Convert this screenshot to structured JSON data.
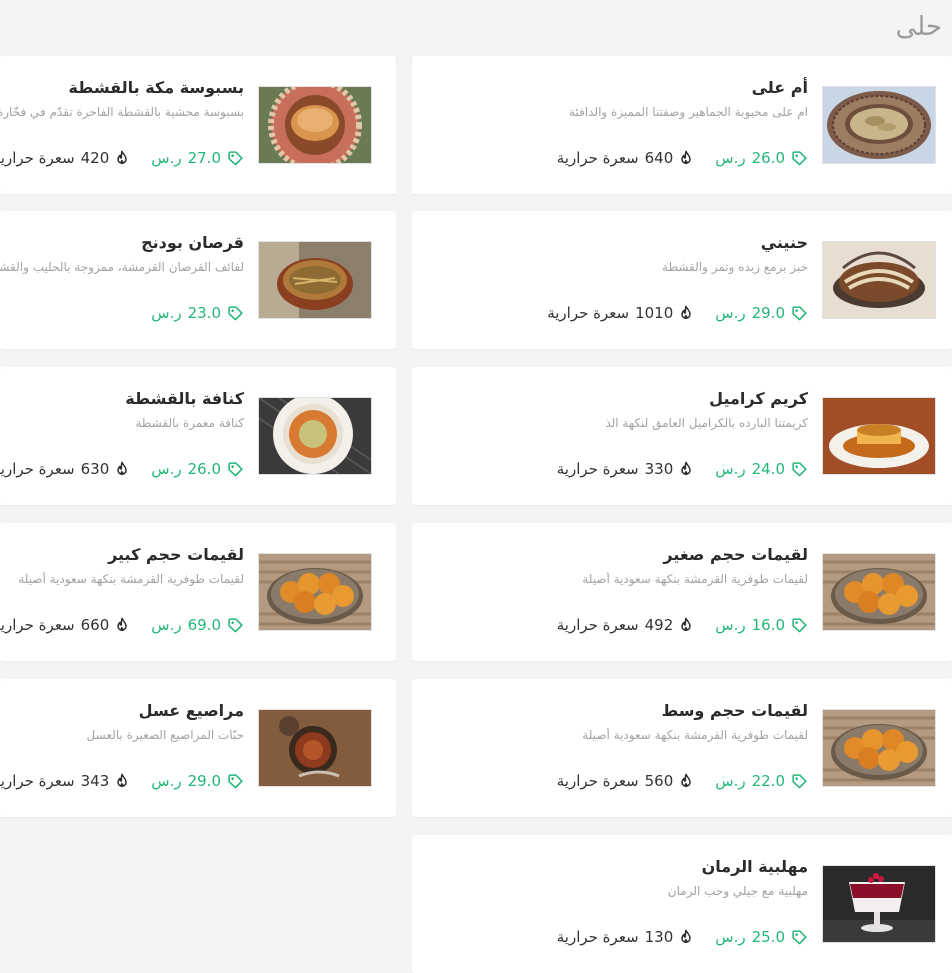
{
  "section": {
    "title": "حلى"
  },
  "items": [
    {
      "name": "أم على",
      "desc": "ام على محبوبة الجماهير وصفتنا المميزة والدافئة",
      "price": "26.0",
      "currency": "ر.س",
      "calories": "640",
      "cal_label": "سعرة حرارية",
      "image": "um-ali-bowl"
    },
    {
      "name": "بسبوسة مكة بالقشطة",
      "desc": "بسبوسة محشية بالقشطة الفاخرة تقدّم في فخّارة",
      "price": "27.0",
      "currency": "ر.س",
      "calories": "420",
      "cal_label": "سعرة حرارية",
      "image": "basbousa-clay-pot"
    },
    {
      "name": "حنيني",
      "desc": "خبز برمع زبده وتمر والقشطة",
      "price": "29.0",
      "currency": "ر.س",
      "calories": "1010",
      "cal_label": "سعرة حرارية",
      "image": "hunaini-dish"
    },
    {
      "name": "قرصان بودنج",
      "desc": "لفائف القرصان القرمشة، ممزوجة بالحليب والقشطة",
      "price": "23.0",
      "currency": "ر.س",
      "calories": "",
      "cal_label": "",
      "image": "qursan-pot"
    },
    {
      "name": "كريم كراميل",
      "desc": "كريمتنا البارده بالكراميل العامق لنكهة الذ",
      "price": "24.0",
      "currency": "ر.س",
      "calories": "330",
      "cal_label": "سعرة حرارية",
      "image": "creme-caramel"
    },
    {
      "name": "كنافة بالقشطة",
      "desc": "كنافة مغمرة بالقشطة",
      "price": "26.0",
      "currency": "ر.س",
      "calories": "630",
      "cal_label": "سعرة حرارية",
      "image": "kunafa-plate"
    },
    {
      "name": "لقيمات حجم صغير",
      "desc": "لقيمات طوفرية القرمشة بنكهة سعودية أصيلة",
      "price": "16.0",
      "currency": "ر.س",
      "calories": "492",
      "cal_label": "سعرة حرارية",
      "image": "luqaimat-bowl"
    },
    {
      "name": "لقيمات حجم كبير",
      "desc": "لقيمات طوفرية القرمشة بنكهة سعودية أصيلة",
      "price": "69.0",
      "currency": "ر.س",
      "calories": "660",
      "cal_label": "سعرة حرارية",
      "image": "luqaimat-bowl"
    },
    {
      "name": "لقيمات حجم وسط",
      "desc": "لقيمات طوفرية القرمشة بنكهة سعودية أصيلة",
      "price": "22.0",
      "currency": "ر.س",
      "calories": "560",
      "cal_label": "سعرة حرارية",
      "image": "luqaimat-bowl"
    },
    {
      "name": "مراصيع عسل",
      "desc": "حبّات المراصيع الصغيرة بالعسل",
      "price": "29.0",
      "currency": "ر.س",
      "calories": "343",
      "cal_label": "سعرة حرارية",
      "image": "marasee-honey"
    },
    {
      "name": "مهلبية الرمان",
      "desc": "مهلبية مع جيلي وحب الرمان",
      "price": "25.0",
      "currency": "ر.س",
      "calories": "130",
      "cal_label": "سعرة حرارية",
      "image": "pomegranate-muhallabia"
    }
  ],
  "colors": {
    "price": "#23b777",
    "text": "#2b2b2b",
    "muted": "#a3a3a3",
    "background": "#f4f4f4"
  }
}
